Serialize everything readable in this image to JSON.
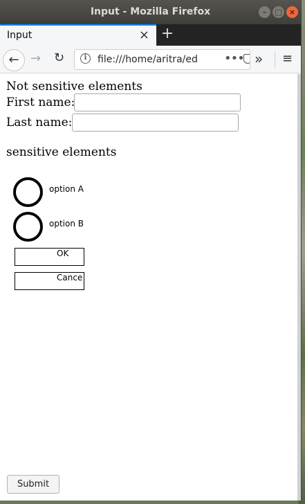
{
  "window": {
    "title": "Input - Mozilla Firefox",
    "minimize_glyph": "–",
    "maximize_glyph": "□",
    "close_glyph": "×"
  },
  "tab": {
    "title": "Input",
    "close_glyph": "×",
    "new_tab_glyph": "+"
  },
  "navbar": {
    "back_glyph": "←",
    "forward_glyph": "→",
    "reload_glyph": "↻",
    "url": "file:///home/aritra/ed",
    "info_glyph": "i",
    "page_actions_glyph": "•••",
    "overflow_glyph": "»",
    "menu_glyph": "≡"
  },
  "page": {
    "heading_not_sensitive": "Not sensitive elements",
    "first_name_label": "First name:",
    "first_name_value": "",
    "last_name_label": "Last name:",
    "last_name_value": "",
    "heading_sensitive": "sensitive elements",
    "option_a_label": "option A",
    "option_b_label": "option B",
    "ok_label": "OK",
    "cancel_label": "Cance",
    "submit_label": "Submit"
  },
  "colors": {
    "accent_tab_indicator": "#0a84ff",
    "titlebar": "#3f3e3a",
    "close_button": "#f0663a"
  }
}
